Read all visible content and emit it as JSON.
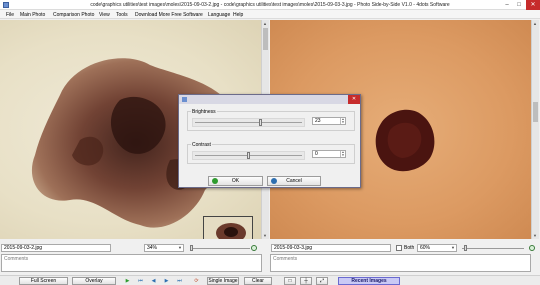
{
  "window": {
    "title": "code\\graphics utilities\\test images\\moles\\2015-09-03-2.jpg - code\\graphics utilities\\test images\\moles\\2015-09-03-3.jpg - Photo Side-by-Side V1.0 - 4dots Software",
    "min_glyph": "–",
    "max_glyph": "□",
    "close_glyph": "✕"
  },
  "menu": [
    "File",
    "Main Photo",
    "Comparison Photo",
    "View",
    "Tools",
    "Download More Free Software",
    "Language",
    "Help"
  ],
  "left_panel": {
    "filename": "2015-09-03-2.jpg",
    "zoom": "34%",
    "comments_placeholder": "Comments"
  },
  "right_panel": {
    "filename": "2015-09-03-3.jpg",
    "both_label": "Both",
    "both_checked": false,
    "zoom": "60%",
    "comments_placeholder": "Comments"
  },
  "toolbar": {
    "full_screen": "Full Screen",
    "overlay": "Overlay",
    "single_image": "Single Image",
    "clear": "Clear",
    "recent_images": "Recent Images"
  },
  "dialog": {
    "close_glyph": "✕",
    "brightness_label": "Brightness",
    "brightness_value": "23",
    "brightness_level": 0.62,
    "contrast_label": "Contrast",
    "contrast_value": "0",
    "contrast_level": 0.5,
    "ok_label": "OK",
    "cancel_label": "Cancel"
  },
  "icons": {
    "play": "play-icon",
    "first": "first-icon",
    "prev": "previous-icon",
    "next": "next-icon",
    "last": "last-icon",
    "refresh": "refresh-icon",
    "zoom": "zoom-icon",
    "expand": "expand-icon"
  },
  "colors": {
    "recent_images_bg": "#c9c9f5",
    "ok_icon": "#2e9b2e",
    "cancel_icon": "#2e6fb0",
    "close_button": "#c62b2b"
  }
}
